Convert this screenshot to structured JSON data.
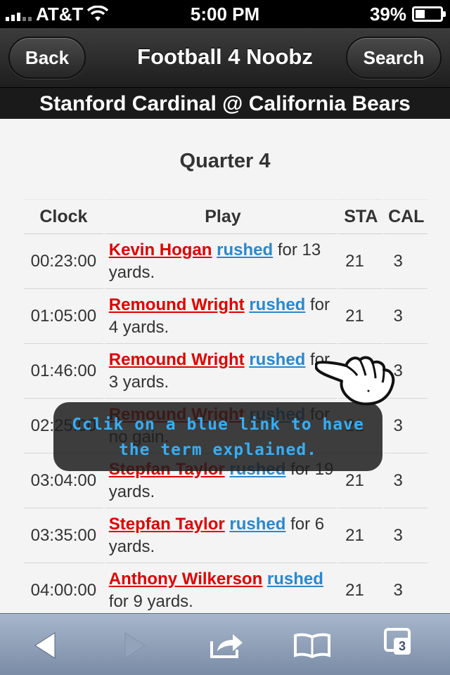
{
  "status_bar": {
    "carrier": "AT&T",
    "time": "5:00 PM",
    "battery": "39%",
    "battery_level": 0.39
  },
  "navbar": {
    "back_label": "Back",
    "title": "Football 4 Noobz",
    "search_label": "Search"
  },
  "game": {
    "title": "Stanford Cardinal @ California Bears"
  },
  "quarter": "Quarter 4",
  "table": {
    "headers": {
      "clock": "Clock",
      "play": "Play",
      "sta": "STA",
      "cal": "CAL"
    },
    "rows": [
      {
        "clock": "00:23:00",
        "player": "Kevin Hogan",
        "term": "rushed",
        "tail": "for 13 yards.",
        "sta": "21",
        "cal": "3"
      },
      {
        "clock": "01:05:00",
        "player": "Remound Wright",
        "term": "rushed",
        "tail": "for 4 yards.",
        "sta": "21",
        "cal": "3"
      },
      {
        "clock": "01:46:00",
        "player": "Remound Wright",
        "term": "rushed",
        "tail": "for 3 yards.",
        "sta": "21",
        "cal": "3"
      },
      {
        "clock": "02:25:00",
        "player": "Remound Wright",
        "term": "rushed",
        "tail": "for no gain.",
        "sta": "21",
        "cal": "3"
      },
      {
        "clock": "03:04:00",
        "player": "Stepfan Taylor",
        "term": "rushed",
        "tail": "for 19 yards.",
        "sta": "21",
        "cal": "3"
      },
      {
        "clock": "03:35:00",
        "player": "Stepfan Taylor",
        "term": "rushed",
        "tail": "for 6 yards.",
        "sta": "21",
        "cal": "3"
      },
      {
        "clock": "04:00:00",
        "player": "Anthony Wilkerson",
        "term": "rushed",
        "tail": "for 9 yards.",
        "sta": "21",
        "cal": "3"
      }
    ]
  },
  "tooltip": {
    "line1": "Cclik on a blue link to have",
    "line2": "the term explained."
  },
  "toolbar": {
    "tabs_count": "3"
  },
  "colors": {
    "player_link": "#e00000",
    "term_link": "#2a88cf",
    "tooltip_text": "#35aef6"
  }
}
